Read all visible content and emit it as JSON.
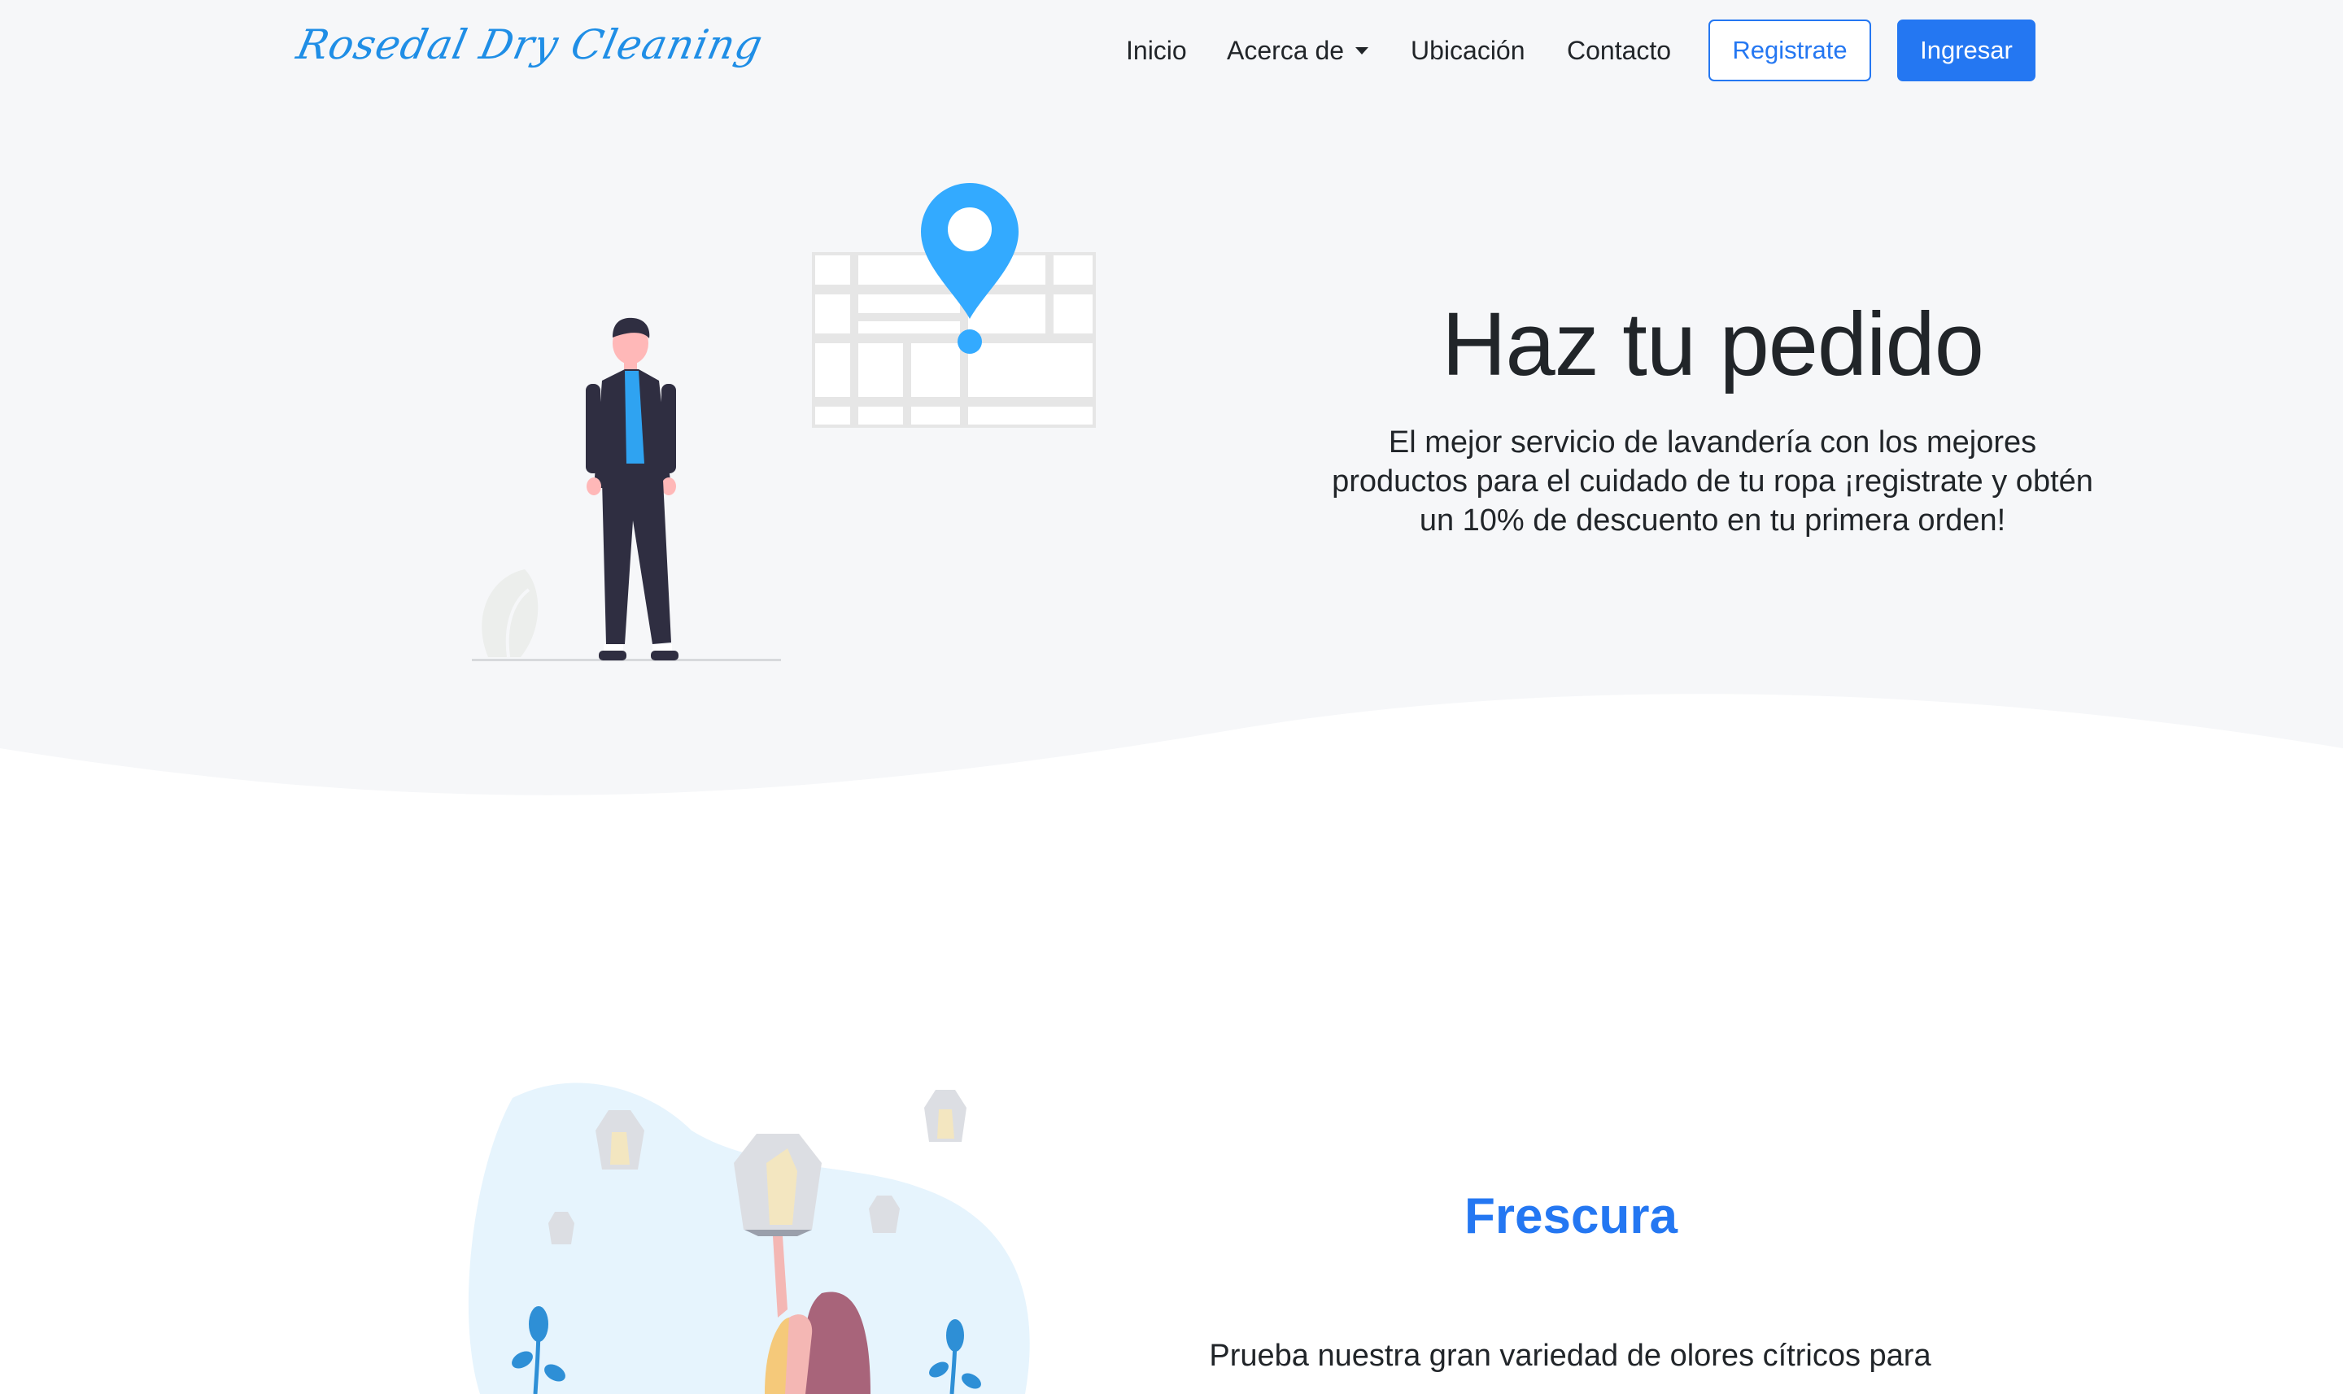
{
  "navbar": {
    "brand": "Rosedal Dry Cleaning",
    "links": [
      "Inicio",
      "Acerca de",
      "Ubicación",
      "Contacto"
    ],
    "register_label": "Registrate",
    "login_label": "Ingresar",
    "dropdown_icon": "caret-down-icon"
  },
  "hero": {
    "title": "Haz tu pedido",
    "text": "El mejor servicio de lavandería con los mejores productos para el cuidado de tu ropa ¡registrate y obtén un 10% de descuento en tu primera orden!",
    "illustration_icon": "man-with-map-pin-illustration"
  },
  "features": {
    "title": "Frescura",
    "text": "Prueba nuestra gran variedad de olores cítricos para",
    "illustration_icon": "woman-with-sky-lanterns-illustration"
  },
  "colors": {
    "accent": "#2477f2",
    "brand": "#1f8ee6",
    "hero_background": "#f6f7f9",
    "pin": "#33aaff"
  }
}
